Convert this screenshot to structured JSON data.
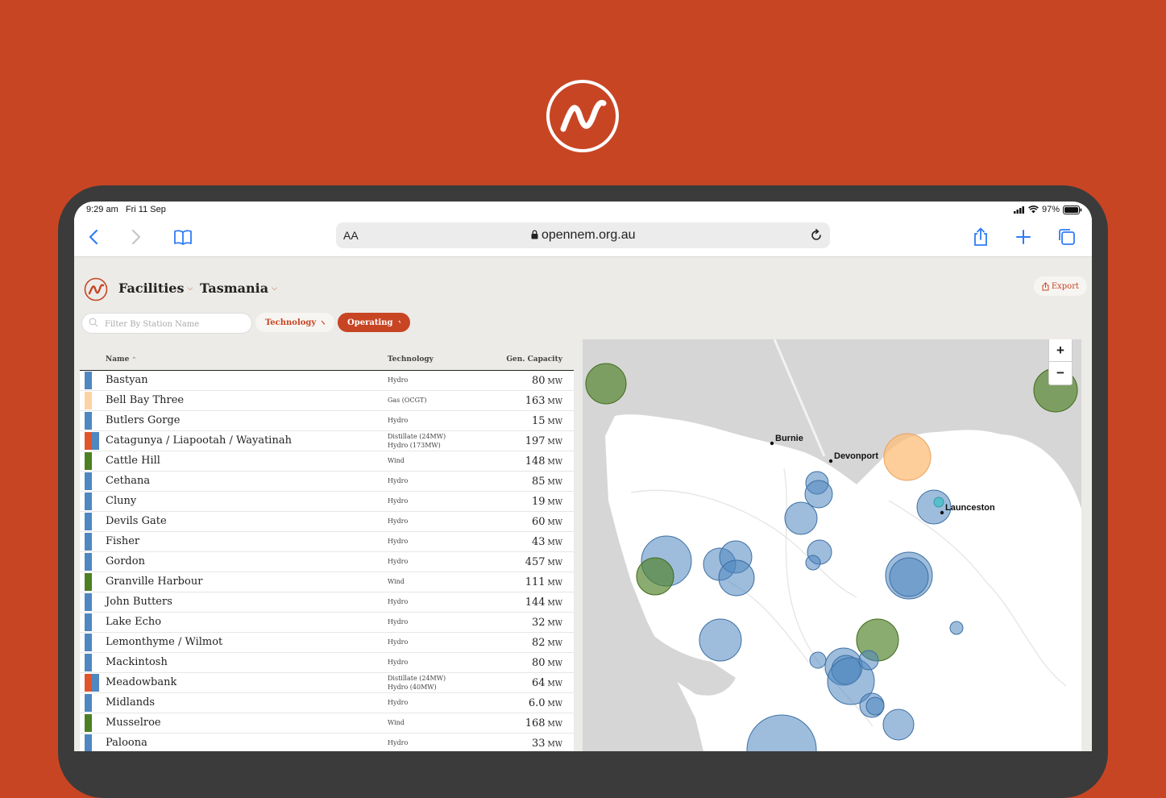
{
  "status": {
    "time": "9:29 am",
    "date": "Fri 11 Sep",
    "battery": "97%"
  },
  "browser": {
    "aa": "AA",
    "url": "opennem.org.au"
  },
  "app": {
    "section": "Facilities",
    "region": "Tasmania",
    "export_label": "Export",
    "search_placeholder": "Filter By Station Name",
    "filter_technology": "Technology",
    "filter_status": "Operating"
  },
  "table": {
    "headers": {
      "name": "Name",
      "technology": "Technology",
      "capacity": "Gen. Capacity"
    },
    "unit": "MW",
    "rows": [
      {
        "name": "Bastyan",
        "tech": [
          "Hydro"
        ],
        "cap": "80",
        "colors": [
          "#4f87c0"
        ]
      },
      {
        "name": "Bell Bay Three",
        "tech": [
          "Gas (OCGT)"
        ],
        "cap": "163",
        "colors": [
          "#fdd3a3"
        ]
      },
      {
        "name": "Butlers Gorge",
        "tech": [
          "Hydro"
        ],
        "cap": "15",
        "colors": [
          "#4f87c0"
        ]
      },
      {
        "name": "Catagunya / Liapootah / Wayatinah",
        "tech": [
          "Distillate (24MW)",
          "Hydro (173MW)"
        ],
        "cap": "197",
        "colors": [
          "#e2542a",
          "#4f87c0"
        ]
      },
      {
        "name": "Cattle Hill",
        "tech": [
          "Wind"
        ],
        "cap": "148",
        "colors": [
          "#4d7f23"
        ]
      },
      {
        "name": "Cethana",
        "tech": [
          "Hydro"
        ],
        "cap": "85",
        "colors": [
          "#4f87c0"
        ]
      },
      {
        "name": "Cluny",
        "tech": [
          "Hydro"
        ],
        "cap": "19",
        "colors": [
          "#4f87c0"
        ]
      },
      {
        "name": "Devils Gate",
        "tech": [
          "Hydro"
        ],
        "cap": "60",
        "colors": [
          "#4f87c0"
        ]
      },
      {
        "name": "Fisher",
        "tech": [
          "Hydro"
        ],
        "cap": "43",
        "colors": [
          "#4f87c0"
        ]
      },
      {
        "name": "Gordon",
        "tech": [
          "Hydro"
        ],
        "cap": "457",
        "colors": [
          "#4f87c0"
        ]
      },
      {
        "name": "Granville Harbour",
        "tech": [
          "Wind"
        ],
        "cap": "111",
        "colors": [
          "#4d7f23"
        ]
      },
      {
        "name": "John Butters",
        "tech": [
          "Hydro"
        ],
        "cap": "144",
        "colors": [
          "#4f87c0"
        ]
      },
      {
        "name": "Lake Echo",
        "tech": [
          "Hydro"
        ],
        "cap": "32",
        "colors": [
          "#4f87c0"
        ]
      },
      {
        "name": "Lemonthyme / Wilmot",
        "tech": [
          "Hydro"
        ],
        "cap": "82",
        "colors": [
          "#4f87c0"
        ]
      },
      {
        "name": "Mackintosh",
        "tech": [
          "Hydro"
        ],
        "cap": "80",
        "colors": [
          "#4f87c0"
        ]
      },
      {
        "name": "Meadowbank",
        "tech": [
          "Distillate (24MW)",
          "Hydro (40MW)"
        ],
        "cap": "64",
        "colors": [
          "#e2542a",
          "#4f87c0"
        ]
      },
      {
        "name": "Midlands",
        "tech": [
          "Hydro"
        ],
        "cap": "6.0",
        "colors": [
          "#4f87c0"
        ]
      },
      {
        "name": "Musselroe",
        "tech": [
          "Wind"
        ],
        "cap": "168",
        "colors": [
          "#4d7f23"
        ]
      },
      {
        "name": "Paloona",
        "tech": [
          "Hydro"
        ],
        "cap": "33",
        "colors": [
          "#4f87c0"
        ]
      }
    ]
  },
  "map": {
    "towns": [
      "Burnie",
      "Devonport",
      "Launceston"
    ],
    "zoom_in": "+",
    "zoom_out": "−"
  },
  "colors": {
    "brand": "#c84524",
    "hydro": "#4f87c0",
    "wind": "#4d7f23",
    "gas": "#fdd3a3",
    "distillate": "#e2542a"
  }
}
